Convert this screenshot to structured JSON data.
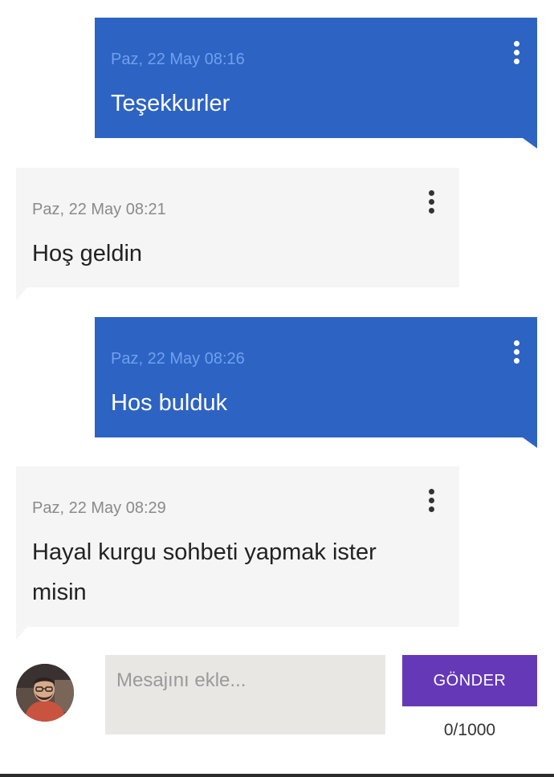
{
  "messages": [
    {
      "direction": "sent",
      "timestamp": "Paz, 22 May 08:16",
      "text": "Teşekkurler"
    },
    {
      "direction": "received",
      "timestamp": "Paz, 22 May 08:21",
      "text": "Hoş geldin"
    },
    {
      "direction": "sent",
      "timestamp": "Paz, 22 May 08:26",
      "text": "Hos bulduk"
    },
    {
      "direction": "received",
      "timestamp": "Paz, 22 May 08:29",
      "text": "Hayal kurgu sohbeti yapmak ister misin"
    }
  ],
  "composer": {
    "placeholder": "Mesajını ekle...",
    "value": "",
    "send_label": "GÖNDER",
    "counter": "0/1000"
  },
  "colors": {
    "sent_bubble": "#2d63c2",
    "received_bubble": "#f5f5f5",
    "send_button": "#6538b8"
  },
  "icons": {
    "message_menu": "more-vertical-icon",
    "user": "avatar"
  }
}
